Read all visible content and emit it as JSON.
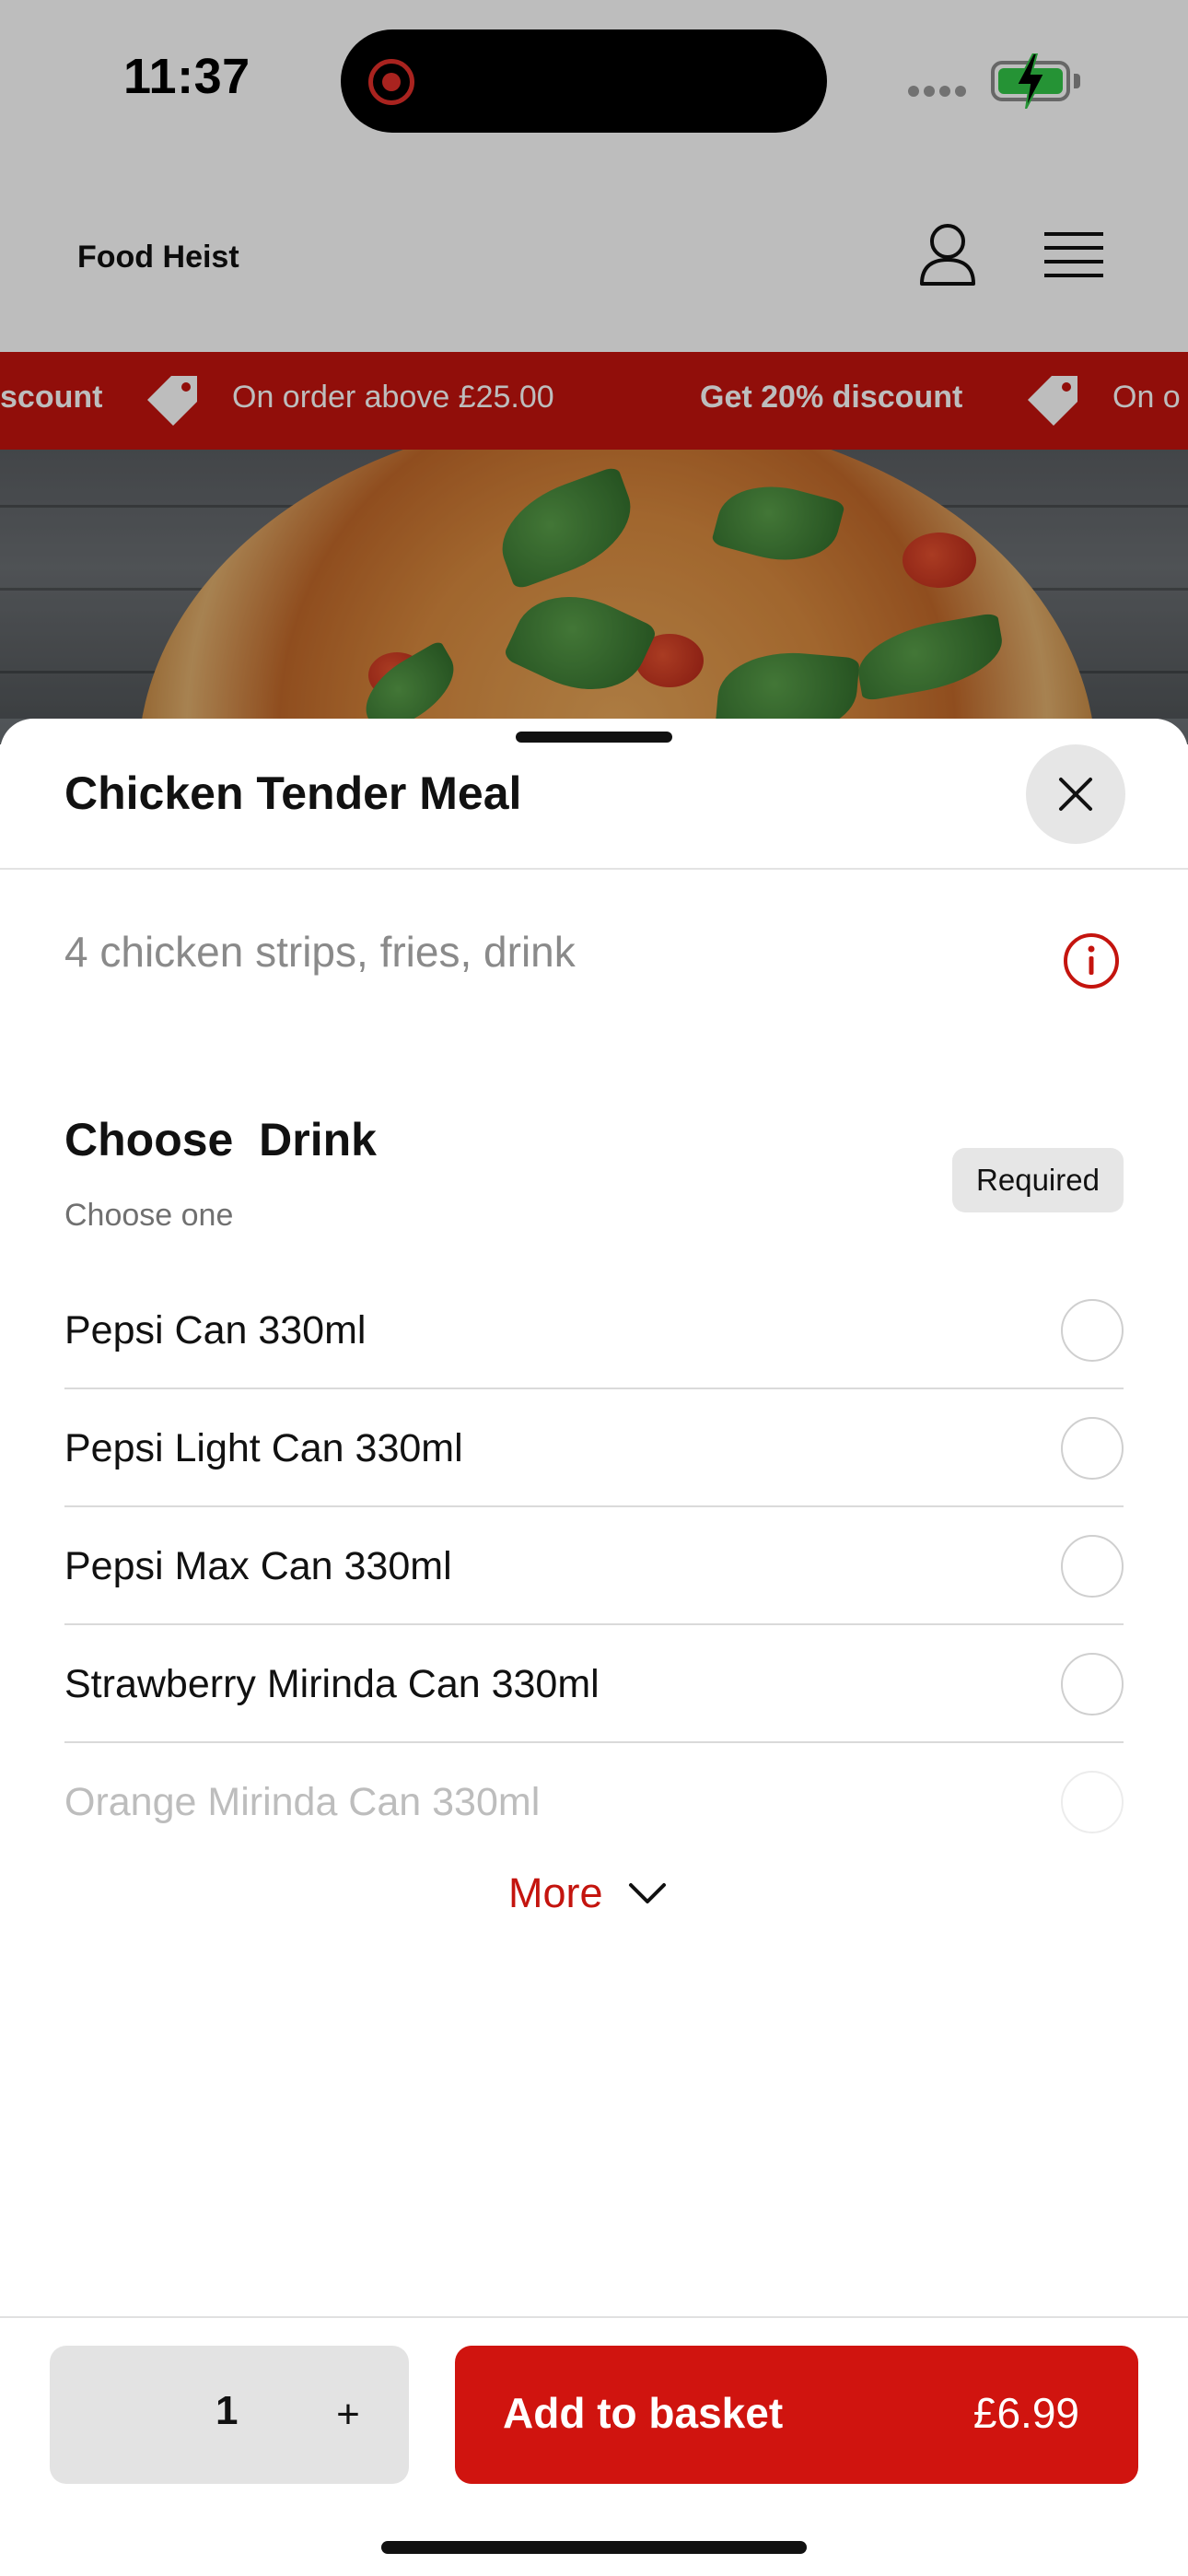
{
  "status_bar": {
    "time": "11:37"
  },
  "header": {
    "brand": "Food Heist"
  },
  "promo": {
    "items": [
      {
        "title": "scount",
        "text": "On order above £25.00"
      },
      {
        "title": "Get 20% discount",
        "text": "On o"
      }
    ]
  },
  "sheet": {
    "title": "Chicken Tender Meal",
    "description": "4 chicken strips, fries, drink",
    "section": {
      "title": "Choose  Drink",
      "subtitle": "Choose one",
      "badge": "Required",
      "options": [
        "Pepsi Can 330ml",
        "Pepsi Light Can 330ml",
        "Pepsi Max Can 330ml",
        "Strawberry Mirinda Can 330ml",
        "Orange Mirinda Can 330ml"
      ]
    },
    "more_label": "More"
  },
  "footer": {
    "quantity": "1",
    "plus_label": "+",
    "add_label": "Add to basket",
    "price": "£6.99"
  },
  "colors": {
    "brand_red": "#c4140e",
    "button_red": "#d0140f"
  }
}
